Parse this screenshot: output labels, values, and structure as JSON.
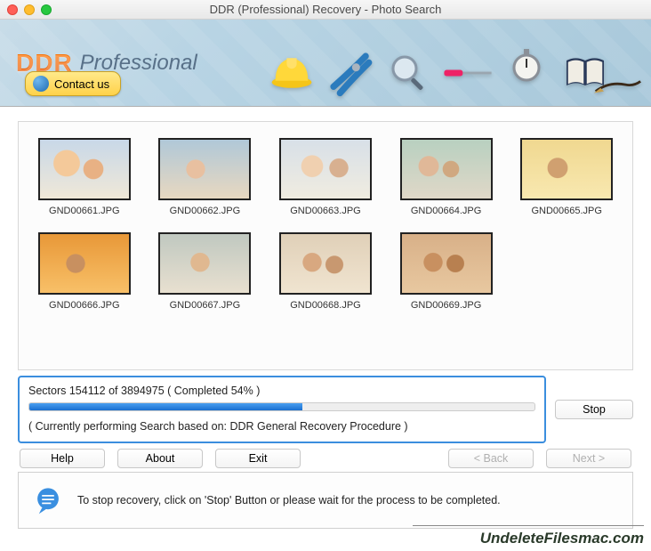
{
  "window": {
    "title": "DDR (Professional) Recovery - Photo Search"
  },
  "banner": {
    "logo_primary": "DDR",
    "logo_secondary": "Professional",
    "contact_label": "Contact us"
  },
  "thumbnails": [
    {
      "filename": "GND00661.JPG"
    },
    {
      "filename": "GND00662.JPG"
    },
    {
      "filename": "GND00663.JPG"
    },
    {
      "filename": "GND00664.JPG"
    },
    {
      "filename": "GND00665.JPG"
    },
    {
      "filename": "GND00666.JPG"
    },
    {
      "filename": "GND00667.JPG"
    },
    {
      "filename": "GND00668.JPG"
    },
    {
      "filename": "GND00669.JPG"
    }
  ],
  "progress": {
    "sectors_current": 154112,
    "sectors_total": 3894975,
    "percent": 54,
    "status_line": "Sectors 154112 of 3894975    ( Completed 54% )",
    "sub_line": "( Currently performing Search based on: DDR General Recovery Procedure )"
  },
  "buttons": {
    "stop": "Stop",
    "help": "Help",
    "about": "About",
    "exit": "Exit",
    "back": "< Back",
    "next": "Next >"
  },
  "hint": {
    "text": "To stop recovery, click on 'Stop' Button or please wait for the process to be completed."
  },
  "watermark": "UndeleteFilesmac.com"
}
